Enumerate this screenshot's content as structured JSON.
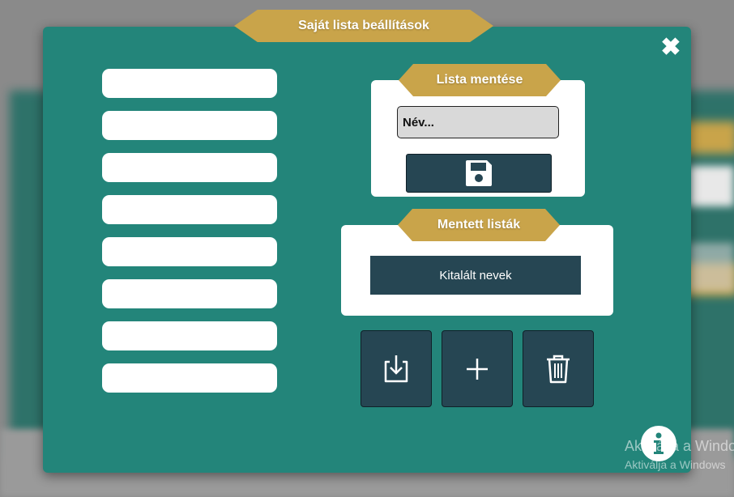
{
  "modal": {
    "title": "Saját lista beállítások",
    "close_icon": "close-icon"
  },
  "slots": [
    "",
    "",
    "",
    "",
    "",
    "",
    "",
    ""
  ],
  "save_section": {
    "title": "Lista mentése",
    "name_placeholder": "Név...",
    "save_icon": "floppy-disk-icon"
  },
  "saved_section": {
    "title": "Mentett listák",
    "items": [
      "Kitalált nevek"
    ]
  },
  "actions": {
    "load_icon": "download-icon",
    "add_icon": "plus-icon",
    "delete_icon": "trash-icon"
  },
  "info": {
    "icon": "info-icon"
  },
  "watermark": {
    "line1": "Aktiválja a Windows",
    "line2": "Aktiválja a Windows"
  },
  "colors": {
    "modal_bg": "#23857a",
    "ribbon": "#c9a44a",
    "dark_button": "#264653",
    "input_bg": "#d9d9d9"
  }
}
